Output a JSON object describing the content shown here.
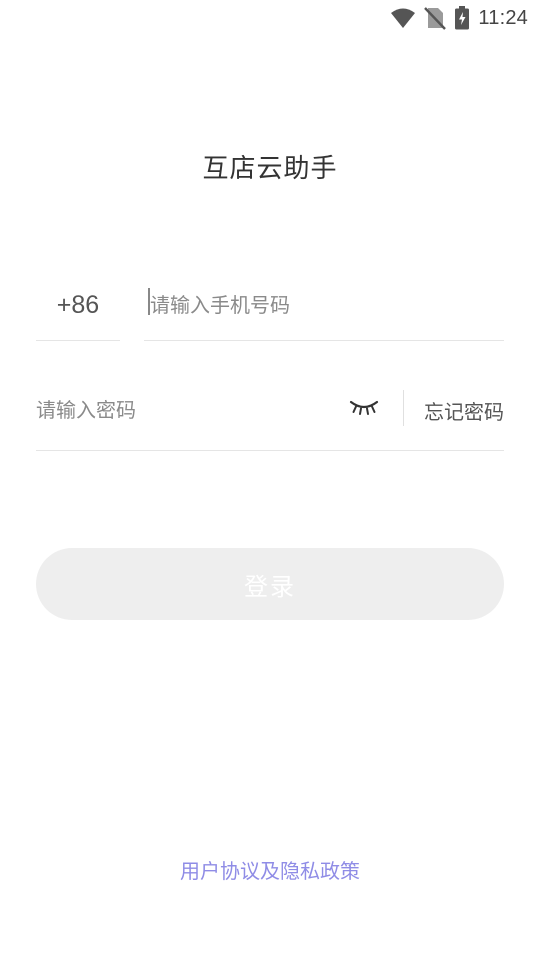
{
  "status_bar": {
    "time": "11:24",
    "icons": [
      "wifi-icon",
      "no-sim-icon",
      "battery-charging-icon"
    ]
  },
  "app": {
    "title": "互店云助手"
  },
  "login_form": {
    "country_code": "+86",
    "phone_value": "",
    "phone_placeholder": "请输入手机号码",
    "password_value": "",
    "password_placeholder": "请输入密码",
    "password_toggle_icon": "eye-closed-icon",
    "forgot_password_label": "忘记密码",
    "submit_label": "登录"
  },
  "footer": {
    "agreement_label": "用户协议及隐私政策"
  },
  "colors": {
    "accent_link": "#8f8ce6",
    "button_disabled_bg": "#eeeeee",
    "button_text": "#ffffff",
    "divider": "#e5e5e5"
  }
}
